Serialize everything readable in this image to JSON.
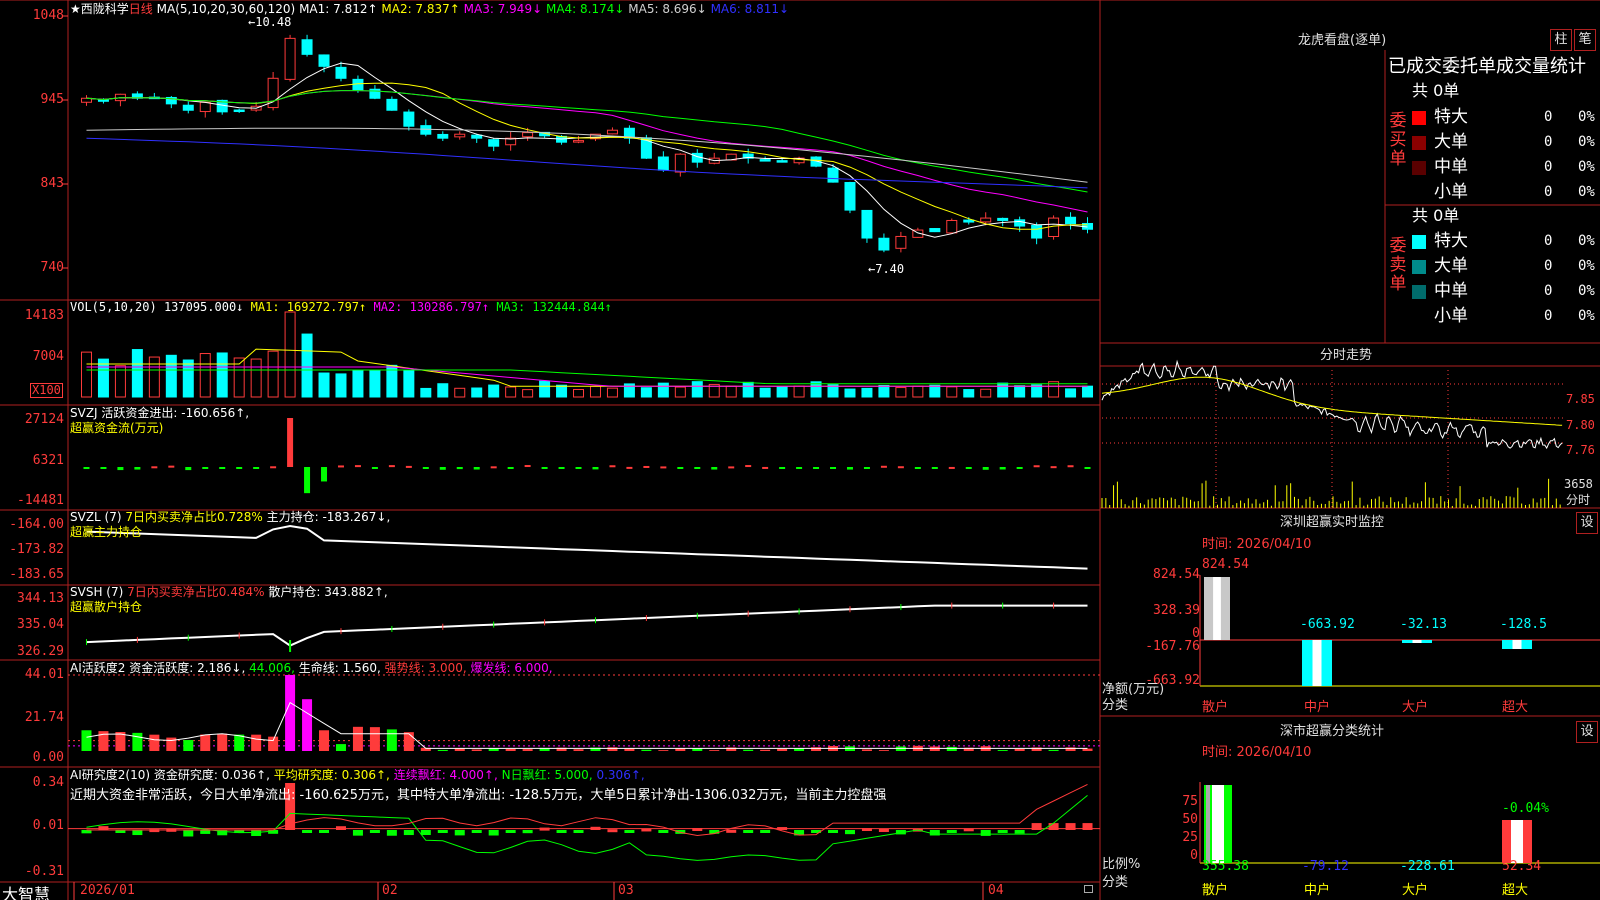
{
  "stock": {
    "star": "★",
    "name": "西陇科学",
    "period": "日线"
  },
  "main": {
    "ma_label": "MA(5,10,20,30,60,120)",
    "ma1": "MA1: 7.812↑",
    "ma2": "MA2: 7.837↑",
    "ma3": "MA3: 7.949↓",
    "ma4": "MA4: 8.174↓",
    "ma5": "MA5: 8.696↓",
    "ma6": "MA6: 8.811↓",
    "high_mark": "←10.48",
    "low_mark": "←7.40",
    "axis": [
      "1048",
      "945",
      "843",
      "740"
    ]
  },
  "vol": {
    "label": "VOL(5,10,20)",
    "v": "137095.000↓",
    "ma1": "MA1: 169272.797↑",
    "ma2": "MA2: 130286.797↑",
    "ma3": "MA3: 132444.844↑",
    "axis": [
      "14183",
      "7004"
    ],
    "unit": "X100"
  },
  "svzj": {
    "label": "SVZJ",
    "t1": "活跃资金进出: -160.656↑,",
    "t2": "超赢资金流(万元)",
    "axis": [
      "27124",
      "6321",
      "-14481"
    ]
  },
  "svzl": {
    "label": "SVZL (7)",
    "t1": "7日内买卖净占比0.728%",
    "t2": "主力持仓: -183.267↓,",
    "t3": "超赢主力持仓",
    "axis": [
      "-164.00",
      "-173.82",
      "-183.65"
    ]
  },
  "svsh": {
    "label": "SVSH (7)",
    "t1": "7日内买卖净占比0.484%",
    "t2": "散户持仓: 343.882↑,",
    "t3": "超赢散户持仓",
    "axis": [
      "344.13",
      "335.04",
      "326.29"
    ]
  },
  "ai1": {
    "label": "AI活跃度2",
    "t1": "资金活跃度: 2.186↓,",
    "t2": "44.006,",
    "t3": "生命线: 1.560,",
    "t4": "强势线: 3.000,",
    "t5": "爆发线: 6.000,",
    "axis": [
      "44.01",
      "21.74",
      "0.00"
    ]
  },
  "ai2": {
    "label": "AI研究度2(10)",
    "t1": "资金研究度: 0.036↑,",
    "t2": "平均研究度: 0.306↑,",
    "t3": "连续飘红: 4.000↑,",
    "t4": "N日飘红: 5.000,",
    "t5": "0.306↑,",
    "comment": "近期大资金非常活跃，今日大单净流出: -160.625万元，其中特大单净流出: -128.5万元，大单5日累计净出-1306.032万元，当前主力控盘强",
    "axis": [
      "0.34",
      "0.01",
      "-0.31"
    ]
  },
  "dates": [
    "2026/01",
    "02",
    "03",
    "04"
  ],
  "brand": "大智慧",
  "lhb": {
    "title": "龙虎看盘(逐单)",
    "btn1": "柱",
    "btn2": "笔",
    "sub": "已成交委托单成交量统计",
    "buy": {
      "side": "委买单",
      "total": "共 0单",
      "rows": [
        {
          "name": "特大",
          "color": "#ff0000",
          "count": "0",
          "pct": "0%"
        },
        {
          "name": "大单",
          "color": "#8b0000",
          "count": "0",
          "pct": "0%"
        },
        {
          "name": "中单",
          "color": "#5a0000",
          "count": "0",
          "pct": "0%"
        },
        {
          "name": "小单",
          "color": "",
          "count": "0",
          "pct": "0%"
        }
      ]
    },
    "sell": {
      "side": "委卖单",
      "total": "共 0单",
      "rows": [
        {
          "name": "特大",
          "color": "#00ffff",
          "count": "0",
          "pct": "0%"
        },
        {
          "name": "大单",
          "color": "#008b8b",
          "count": "0",
          "pct": "0%"
        },
        {
          "name": "中单",
          "color": "#006b6b",
          "count": "0",
          "pct": "0%"
        },
        {
          "name": "小单",
          "color": "",
          "count": "0",
          "pct": "0%"
        }
      ]
    }
  },
  "fs": {
    "title": "分时走势",
    "axis": [
      "7.85",
      "7.80",
      "7.76"
    ],
    "vol": "3658",
    "vol_unit": "分时"
  },
  "szjk": {
    "title": "深圳超赢实时监控",
    "btn": "设",
    "time": "时间: 2026/04/10",
    "top_label": "824.54",
    "axis": [
      "824.54",
      "328.39",
      "0",
      "-167.76",
      "-663.92"
    ],
    "ylabel": "净额(万元)",
    "xlabel": "分类",
    "cats": [
      "散户",
      "中户",
      "大户",
      "超大"
    ],
    "vals": [
      "-663.92",
      "-32.13",
      "-128.5"
    ]
  },
  "szfl": {
    "title": "深市超赢分类统计",
    "btn": "设",
    "time": "时间: 2026/04/10",
    "axis": [
      "75",
      "50",
      "25",
      "0"
    ],
    "ylabel": "比例%",
    "xlabel": "分类",
    "cats": [
      "散户",
      "中户",
      "大户",
      "超大"
    ],
    "top": "-0.04%",
    "vals": [
      "355.38",
      "-79.12",
      "-228.61",
      "52.34"
    ]
  }
}
